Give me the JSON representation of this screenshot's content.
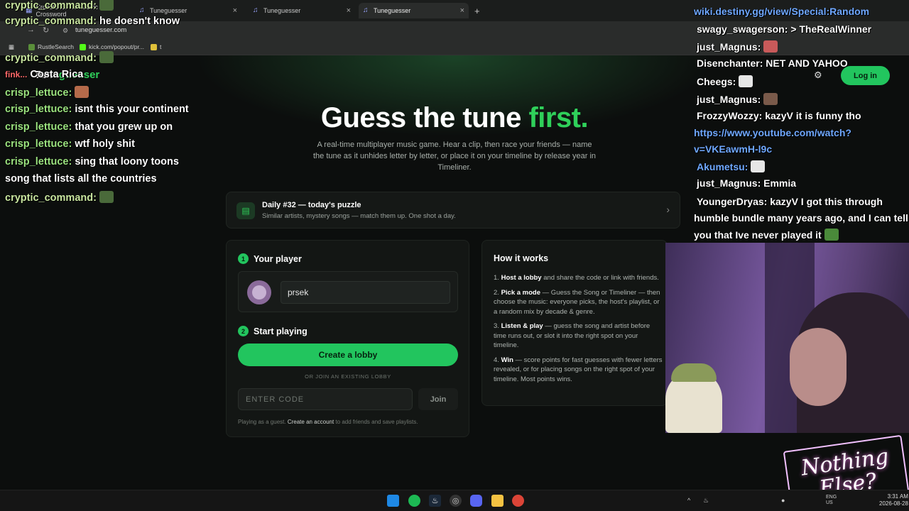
{
  "browser": {
    "tabs": [
      {
        "title": "Crosstune: The Music Crossword"
      },
      {
        "title": "Tuneguesser"
      },
      {
        "title": "Tuneguesser"
      },
      {
        "title": "Tuneguesser"
      }
    ],
    "url": "tuneguesser.com",
    "bookmarks": [
      "RustleSearch",
      "kick.com/popout/pr...",
      "t"
    ]
  },
  "site": {
    "brand_a": "Tune",
    "brand_b": "guesser",
    "login_label": "Log in",
    "hero_a": "Guess the tune ",
    "hero_b": "first.",
    "subtitle": "A real-time multiplayer music game. Hear a clip, then race your friends — name the tune as it unhides letter by letter, or place it on your timeline by release year in Timeliner.",
    "daily": {
      "title": "Daily #32 — today's puzzle",
      "subtitle": "Similar artists, mystery songs — match them up. One shot a day."
    },
    "player": {
      "step1_num": "1",
      "step1_label": "Your player",
      "name_value": "prsek",
      "step2_num": "2",
      "step2_label": "Start playing",
      "create_label": "Create a lobby",
      "or_join": "OR JOIN AN EXISTING LOBBY",
      "code_placeholder": "ENTER CODE",
      "join_label": "Join",
      "guest_pre": "Playing as a guest. ",
      "guest_link": "Create an account",
      "guest_post": " to add friends and save playlists."
    },
    "how": {
      "title": "How it works",
      "steps": [
        {
          "n": "1.",
          "bold": "Host a lobby",
          "rest": " and share the code or link with friends."
        },
        {
          "n": "2.",
          "bold": "Pick a mode",
          "rest": " — Guess the Song or Timeliner — then choose the music: everyone picks, the host's playlist, or a random mix by decade & genre."
        },
        {
          "n": "3.",
          "bold": "Listen & play",
          "rest": " — guess the song and artist before time runs out, or slot it into the right spot on your timeline."
        },
        {
          "n": "4.",
          "bold": "Win",
          "rest": " — score points for fast guesses with fewer letters revealed, or for placing songs on the right spot of your timeline. Most points wins."
        }
      ]
    }
  },
  "chat_left": [
    {
      "user": "cryptic_command:",
      "msg": ""
    },
    {
      "user": "cryptic_command:",
      "msg": "he doesn't know"
    },
    {
      "user": "cryptic_command:",
      "msg": ""
    },
    {
      "user": "fink...",
      "msg": "Costa Rica"
    },
    {
      "user": "crisp_lettuce:",
      "msg": ""
    },
    {
      "user": "crisp_lettuce:",
      "msg": "isnt this your continent"
    },
    {
      "user": "crisp_lettuce:",
      "msg": "that you grew up on"
    },
    {
      "user": "crisp_lettuce:",
      "msg": "wtf holy shit"
    },
    {
      "user": "crisp_lettuce:",
      "msg": "sing that loony toons"
    },
    {
      "user": "",
      "msg": "song that lists all the countries"
    },
    {
      "user": "cryptic_command:",
      "msg": ""
    }
  ],
  "chat_right": [
    {
      "text": "wiki.destiny.gg/view/Special:Random",
      "link": true
    },
    {
      "text": "swagy_swagerson: > TheRealWinner",
      "link": false
    },
    {
      "text": "just_Magnus:",
      "link": false
    },
    {
      "text": "Disenchanter: NET AND YAHOO",
      "link": false
    },
    {
      "text": "Cheegs:",
      "link": false
    },
    {
      "text": "just_Magnus:",
      "link": false
    },
    {
      "text": "FrozzyWozzy: kazyV it is funny tho",
      "link": false
    },
    {
      "text": "https://www.youtube.com/watch?",
      "link": true
    },
    {
      "text": "v=VKEawmH-l9c",
      "link": true
    },
    {
      "text": "Akumetsu:",
      "link": false
    },
    {
      "text": "just_Magnus:          Emmia",
      "link": false
    },
    {
      "text": "YoungerDryas: kazyV I got this through",
      "link": false
    },
    {
      "text": "humble bundle many years ago, and I can tell",
      "link": false
    },
    {
      "text": "you that Ive never played it",
      "link": false
    }
  ],
  "overlay_logo": "Nothing Else?",
  "taskbar": {
    "clock_time": "3:31 AM",
    "clock_date": "2026-08-28",
    "lang": "ENG US"
  },
  "colors": {
    "accent": "#22c55e",
    "background": "#0c0e0d"
  }
}
